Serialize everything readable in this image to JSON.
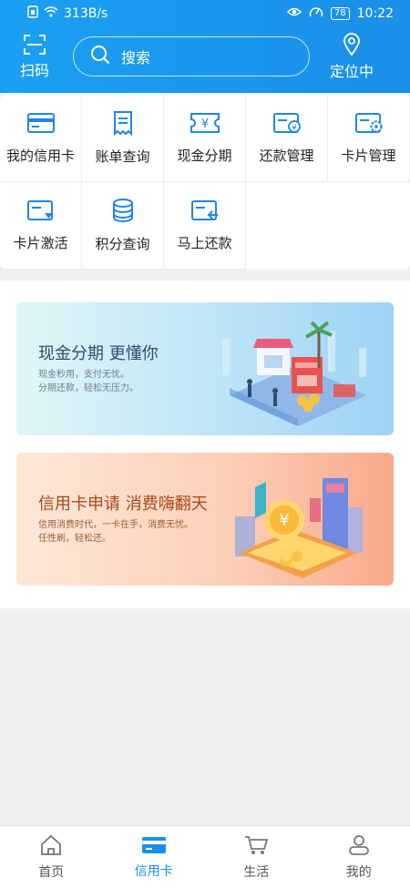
{
  "status_bar": {
    "network_speed": "313B/s",
    "battery": "78",
    "time": "10:22"
  },
  "header": {
    "scan_label": "扫码",
    "search_placeholder": "搜索",
    "location_label": "定位中"
  },
  "menu": {
    "items": [
      {
        "label": "我的信用卡",
        "icon": "credit-card-icon"
      },
      {
        "label": "账单查询",
        "icon": "bill-icon"
      },
      {
        "label": "现金分期",
        "icon": "cash-installment-icon"
      },
      {
        "label": "还款管理",
        "icon": "repayment-icon"
      },
      {
        "label": "卡片管理",
        "icon": "card-settings-icon"
      },
      {
        "label": "卡片激活",
        "icon": "card-activate-icon"
      },
      {
        "label": "积分查询",
        "icon": "points-icon"
      },
      {
        "label": "马上还款",
        "icon": "quick-repay-icon"
      }
    ]
  },
  "banners": [
    {
      "title": "现金分期 更懂你",
      "lines": [
        "现金秒用，支付无忧。",
        "分期还款，轻松无压力。"
      ]
    },
    {
      "title": "信用卡申请 消费嗨翻天",
      "lines": [
        "信用消费时代，一卡在手，消费无忧。",
        "任性刷，轻松还。"
      ]
    }
  ],
  "tabbar": {
    "active": "信用卡",
    "tabs": [
      {
        "label": "首页",
        "icon": "home-icon"
      },
      {
        "label": "信用卡",
        "icon": "credit-card-icon"
      },
      {
        "label": "生活",
        "icon": "cart-icon"
      },
      {
        "label": "我的",
        "icon": "user-icon"
      }
    ]
  },
  "colors": {
    "primary": "#1a8fe8",
    "icon_blue": "#1f86e6",
    "banner1": "#bfe6f7",
    "banner2": "#fcd0b8"
  }
}
